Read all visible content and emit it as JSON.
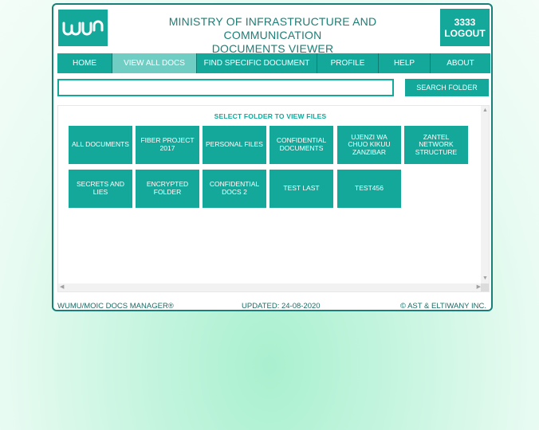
{
  "header": {
    "logo_text": "wumu",
    "title_line1": "MINISTRY OF INFRASTRUCTURE AND COMMUNICATION",
    "title_line2": "DOCUMENTS VIEWER",
    "user_id": "3333",
    "logout_label": "LOGOUT"
  },
  "nav": {
    "items": [
      {
        "label": "HOME"
      },
      {
        "label": "VIEW ALL DOCS"
      },
      {
        "label": "FIND SPECIFIC DOCUMENT"
      },
      {
        "label": "PROFILE"
      },
      {
        "label": "HELP"
      },
      {
        "label": "ABOUT"
      }
    ],
    "active": "VIEW ALL DOCS"
  },
  "search": {
    "value": "",
    "placeholder": "",
    "button_label": "SEARCH FOLDER"
  },
  "folders": {
    "title": "SELECT FOLDER TO VIEW FILES",
    "items": [
      {
        "label": "ALL DOCUMENTS"
      },
      {
        "label": "FIBER PROJECT 2017"
      },
      {
        "label": "PERSONAL FILES"
      },
      {
        "label": "CONFIDENTIAL DOCUMENTS"
      },
      {
        "label": "UJENZI WA CHUO KIKUU ZANZIBAR"
      },
      {
        "label": "ZANTEL NETWORK STRUCTURE"
      },
      {
        "label": "SECRETS AND LIES"
      },
      {
        "label": "ENCRYPTED FOLDER"
      },
      {
        "label": "CONFIDENTIAL DOCS 2"
      },
      {
        "label": "TEST LAST"
      },
      {
        "label": "TEST456"
      }
    ]
  },
  "footer": {
    "left": "WUMU/MOIC DOCS MANAGER®",
    "center": "UPDATED: 24-08-2020",
    "right": "© AST & ELTIWANY INC."
  },
  "colors": {
    "accent": "#13a89a",
    "active_tab": "#6fcdc3",
    "title_text": "#1a7f76",
    "background_glow": "#a9f0cf"
  }
}
